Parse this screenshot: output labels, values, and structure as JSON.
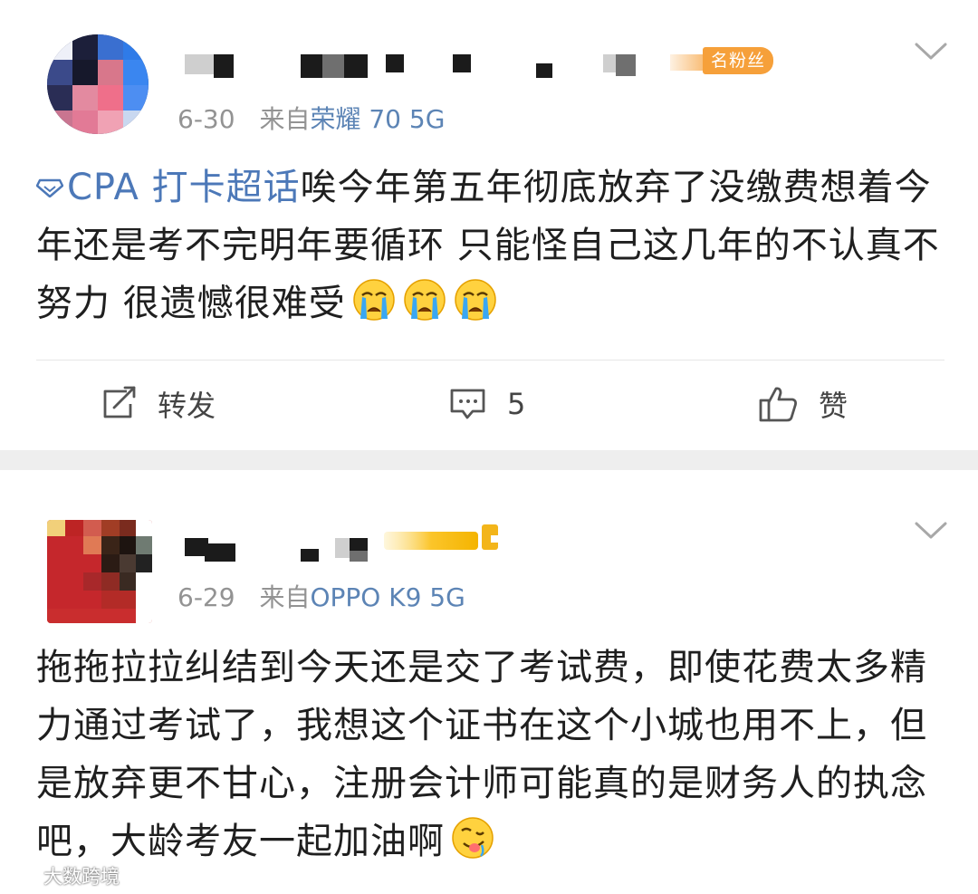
{
  "posts": [
    {
      "fan_badge": "名粉丝",
      "date": "6-30",
      "source_prefix": "来自",
      "source_device": "荣耀 70 5G",
      "topic": "CPA 打卡超话",
      "text": "唉今年第五年彻底放弃了没缴费想着今年还是考不完明年要循环 只能怪自己这几年的不认真不努力 很遗憾很难受",
      "emojis": [
        "crying-face-emoji",
        "crying-face-emoji",
        "crying-face-emoji"
      ],
      "actions": {
        "repost": "转发",
        "comment_count": "5",
        "like": "赞"
      }
    },
    {
      "date": "6-29",
      "source_prefix": "来自",
      "source_device": "OPPO K9 5G",
      "text": "拖拖拉拉纠结到今天还是交了考试费，即使花费太多精力通过考试了，我想这个证书在这个小城也用不上，但是放弃更不甘心，注册会计师可能真的是财务人的执念吧，大龄考友一起加油啊",
      "emojis": [
        "drooling-face-emoji"
      ]
    }
  ],
  "watermark": "大数跨境",
  "colors": {
    "link_blue": "#4c78b8",
    "meta_gray": "#939393",
    "fan_badge_orange": "#f6a03a",
    "divider_band": "#eeeeee"
  }
}
